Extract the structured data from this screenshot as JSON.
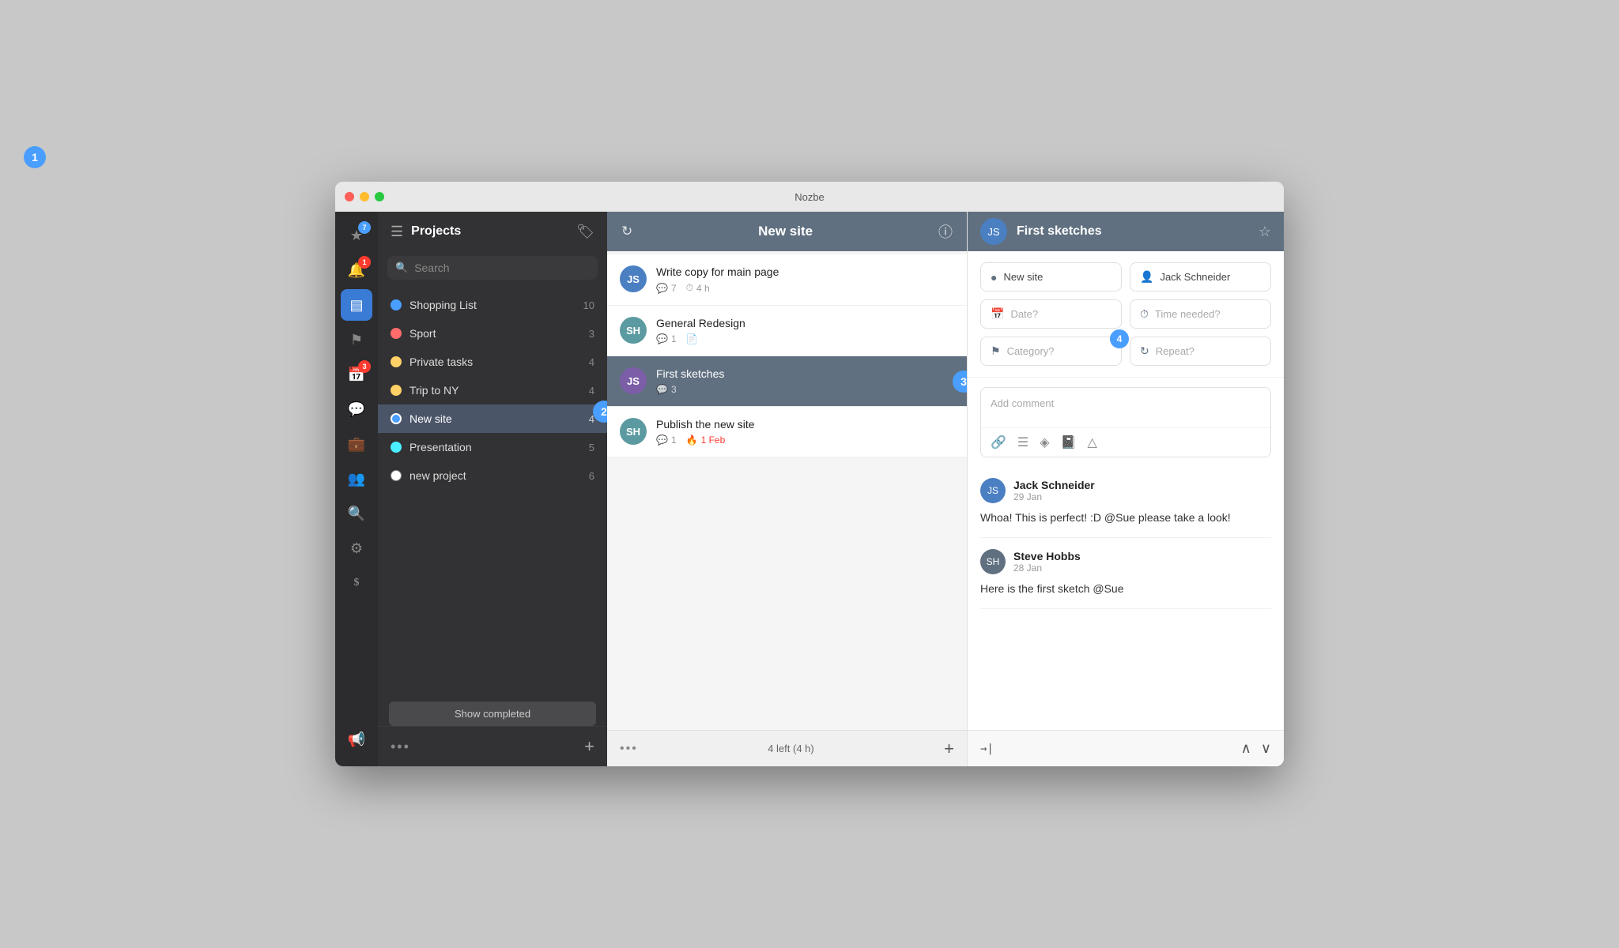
{
  "app": {
    "title": "Nozbe"
  },
  "window_controls": {
    "red_label": "close",
    "yellow_label": "minimize",
    "green_label": "maximize"
  },
  "icon_sidebar": {
    "icons": [
      {
        "name": "star-icon",
        "symbol": "★",
        "badge": "7",
        "badge_color": "blue",
        "active": true
      },
      {
        "name": "notification-icon",
        "symbol": "🔔",
        "badge": "1",
        "badge_color": "red",
        "active": false
      },
      {
        "name": "projects-icon",
        "symbol": "▤",
        "badge": null,
        "active": true
      },
      {
        "name": "flag-icon",
        "symbol": "⚑",
        "badge": null,
        "active": false
      },
      {
        "name": "calendar-icon",
        "symbol": "📅",
        "badge": "3",
        "badge_color": "red",
        "active": false
      },
      {
        "name": "chat-icon",
        "symbol": "💬",
        "badge": null,
        "active": false
      },
      {
        "name": "bag-icon",
        "symbol": "💼",
        "badge": null,
        "active": false
      },
      {
        "name": "team-icon",
        "symbol": "👥",
        "badge": null,
        "active": false
      },
      {
        "name": "search-icon",
        "symbol": "🔍",
        "badge": null,
        "active": false
      },
      {
        "name": "settings-icon",
        "symbol": "⚙",
        "badge": null,
        "active": false
      },
      {
        "name": "money-icon",
        "symbol": "$",
        "badge": null,
        "active": false
      },
      {
        "name": "megaphone-icon",
        "symbol": "📢",
        "badge": null,
        "active": false
      }
    ]
  },
  "projects_panel": {
    "title": "Projects",
    "search_placeholder": "Search",
    "projects": [
      {
        "name": "Shopping List",
        "color": "#4a9eff",
        "count": 10,
        "active": false
      },
      {
        "name": "Sport",
        "color": "#ff6b6b",
        "count": 3,
        "active": false
      },
      {
        "name": "Private tasks",
        "color": "#ffd166",
        "count": 4,
        "active": false
      },
      {
        "name": "Trip to NY",
        "color": "#ffd166",
        "count": 4,
        "active": false
      },
      {
        "name": "New site",
        "color": "#4a9eff",
        "count": 4,
        "active": true
      },
      {
        "name": "Presentation",
        "color": "#4af0ff",
        "count": 5,
        "active": false
      },
      {
        "name": "new project",
        "color": "#ffffff",
        "count": 6,
        "active": false
      }
    ],
    "show_completed_label": "Show completed",
    "footer_dots": "•••",
    "footer_plus": "+"
  },
  "tasks_panel": {
    "header_title": "New site",
    "tasks": [
      {
        "title": "Write copy for main page",
        "avatar_initials": "JS",
        "avatar_color": "blue",
        "comments": 7,
        "time": "4 h",
        "due": null,
        "active": false
      },
      {
        "title": "General Redesign",
        "avatar_initials": "SH",
        "avatar_color": "teal",
        "comments": 1,
        "has_note": true,
        "due": null,
        "active": false
      },
      {
        "title": "First sketches",
        "avatar_initials": "JS",
        "avatar_color": "purple",
        "comments": 3,
        "due": null,
        "active": true
      },
      {
        "title": "Publish the new site",
        "avatar_initials": "SH",
        "avatar_color": "teal",
        "comments": 1,
        "due": "1 Feb",
        "due_overdue": true,
        "active": false
      }
    ],
    "footer_dots": "•••",
    "footer_count": "4 left (4 h)",
    "footer_plus": "+"
  },
  "detail_panel": {
    "task_title": "First sketches",
    "avatar_initials": "JS",
    "project_label": "New site",
    "assignee_label": "Jack Schneider",
    "date_placeholder": "Date?",
    "time_placeholder": "Time needed?",
    "category_placeholder": "Category?",
    "repeat_placeholder": "Repeat?",
    "comment_placeholder": "Add comment",
    "comments": [
      {
        "author": "Jack Schneider",
        "date": "29 Jan",
        "text": "Whoa! This is perfect! :D @Sue please take a look!",
        "avatar_initials": "JS",
        "avatar_color": "#4a7fc1"
      },
      {
        "author": "Steve Hobbs",
        "date": "28 Jan",
        "text": "Here is the first sketch @Sue",
        "avatar_initials": "SH",
        "avatar_color": "#607080"
      }
    ],
    "footer_forward": "→|",
    "footer_up": "∧",
    "footer_down": "∨"
  },
  "tutorial_badges": {
    "badge1": "1",
    "badge2": "2",
    "badge3": "3",
    "badge4": "4"
  }
}
